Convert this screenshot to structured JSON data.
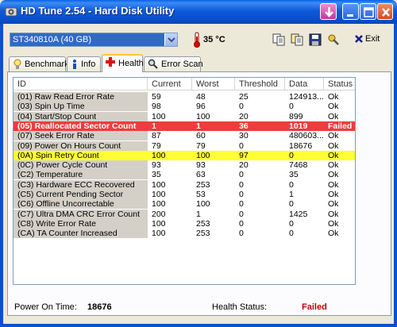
{
  "window": {
    "title": "HD Tune 2.54 - Hard Disk Utility"
  },
  "toolbar": {
    "drive": "ST340810A (40 GB)",
    "temperature": "35 °C",
    "exit_label": "Exit"
  },
  "tabs": [
    {
      "label": "Benchmark",
      "icon": "benchmark-icon"
    },
    {
      "label": "Info",
      "icon": "info-icon"
    },
    {
      "label": "Health",
      "icon": "health-cross-icon",
      "active": true
    },
    {
      "label": "Error Scan",
      "icon": "magnifier-icon"
    }
  ],
  "table": {
    "headers": [
      "ID",
      "Current",
      "Worst",
      "Threshold",
      "Data",
      "Status"
    ],
    "rows": [
      {
        "id": "(01) Raw Read Error Rate",
        "current": "59",
        "worst": "48",
        "threshold": "25",
        "data": "124913...",
        "status": "Ok"
      },
      {
        "id": "(03) Spin Up Time",
        "current": "98",
        "worst": "96",
        "threshold": "0",
        "data": "0",
        "status": "Ok"
      },
      {
        "id": "(04) Start/Stop Count",
        "current": "100",
        "worst": "100",
        "threshold": "20",
        "data": "899",
        "status": "Ok"
      },
      {
        "id": "(05) Reallocated Sector Count",
        "current": "1",
        "worst": "1",
        "threshold": "36",
        "data": "1019",
        "status": "Failed",
        "highlight": "red"
      },
      {
        "id": "(07) Seek Error Rate",
        "current": "87",
        "worst": "60",
        "threshold": "30",
        "data": "480603...",
        "status": "Ok"
      },
      {
        "id": "(09) Power On Hours Count",
        "current": "79",
        "worst": "79",
        "threshold": "0",
        "data": "18676",
        "status": "Ok"
      },
      {
        "id": "(0A) Spin Retry Count",
        "current": "100",
        "worst": "100",
        "threshold": "97",
        "data": "0",
        "status": "Ok",
        "highlight": "yellow"
      },
      {
        "id": "(0C) Power Cycle Count",
        "current": "93",
        "worst": "93",
        "threshold": "20",
        "data": "7468",
        "status": "Ok"
      },
      {
        "id": "(C2) Temperature",
        "current": "35",
        "worst": "63",
        "threshold": "0",
        "data": "35",
        "status": "Ok"
      },
      {
        "id": "(C3) Hardware ECC Recovered",
        "current": "100",
        "worst": "253",
        "threshold": "0",
        "data": "0",
        "status": "Ok"
      },
      {
        "id": "(C5) Current Pending Sector",
        "current": "100",
        "worst": "53",
        "threshold": "0",
        "data": "1",
        "status": "Ok"
      },
      {
        "id": "(C6) Offline Uncorrectable",
        "current": "100",
        "worst": "100",
        "threshold": "0",
        "data": "0",
        "status": "Ok"
      },
      {
        "id": "(C7) Ultra DMA CRC Error Count",
        "current": "200",
        "worst": "1",
        "threshold": "0",
        "data": "1425",
        "status": "Ok"
      },
      {
        "id": "(C8) Write Error Rate",
        "current": "100",
        "worst": "253",
        "threshold": "0",
        "data": "0",
        "status": "Ok"
      },
      {
        "id": "(CA) TA Counter Increased",
        "current": "100",
        "worst": "253",
        "threshold": "0",
        "data": "0",
        "status": "Ok"
      }
    ]
  },
  "footer": {
    "power_on_label": "Power On Time:",
    "power_on_value": "18676",
    "health_label": "Health Status:",
    "health_value": "Failed"
  },
  "colors": {
    "failed_row": "#ef3c3c",
    "warning_row": "#ffff33",
    "failed_text": "#c00000"
  }
}
